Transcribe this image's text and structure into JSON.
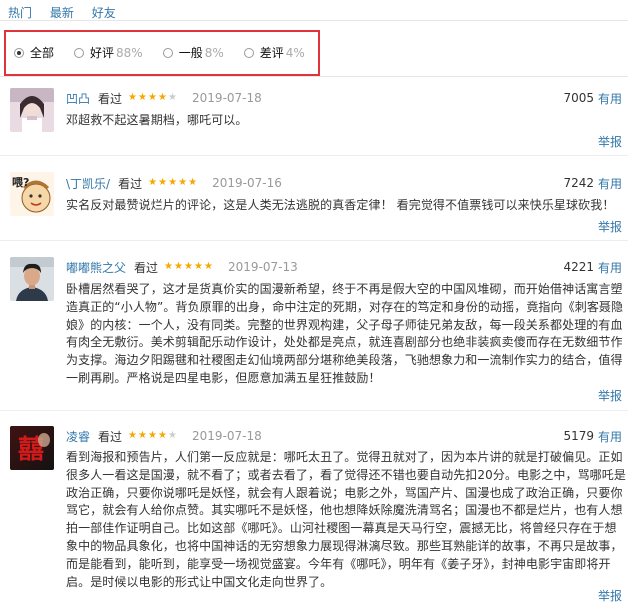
{
  "tabs": [
    "热门",
    "最新",
    "好友"
  ],
  "filters": [
    {
      "label": "全部",
      "pct": "",
      "checked": true
    },
    {
      "label": "好评",
      "pct": "88%",
      "checked": false
    },
    {
      "label": "一般",
      "pct": "8%",
      "checked": false
    },
    {
      "label": "差评",
      "pct": "4%",
      "checked": false
    }
  ],
  "colors": {
    "link": "#3377aa",
    "star": "#f4a800",
    "highlight_box": "#e0343c"
  },
  "reviews": [
    {
      "author": "凹凸",
      "watched": "看过",
      "rating": 4,
      "date": "2019-07-18",
      "votes": "7005",
      "useful": "有用",
      "report": "举报",
      "content": "邓超救不起这暑期档，哪吒可以。",
      "avatar_icon": "girl-photo-avatar"
    },
    {
      "author": "\\丁凯乐/",
      "watched": "看过",
      "rating": 5,
      "date": "2019-07-16",
      "votes": "7242",
      "useful": "有用",
      "report": "举报",
      "content": "实名反对最赞说烂片的评论，这是人类无法逃脱的真香定律！ 看完觉得不值票钱可以来快乐星球砍我！",
      "avatar_icon": "cartoon-avatar"
    },
    {
      "author": "嘟嘟熊之父",
      "watched": "看过",
      "rating": 5,
      "date": "2019-07-13",
      "votes": "4221",
      "useful": "有用",
      "report": "举报",
      "content": "卧槽居然看哭了，这才是货真价实的国漫新希望，终于不再是假大空的中国风堆砌，而开始借神话寓言塑造真正的“小人物”。背负原罪的出身，命中注定的死期，对存在的笃定和身份的动摇，竟指向《刺客聂隐娘》的内核：一个人，没有同类。完整的世界观构建，父子母子师徒兄弟友敌，每一段关系都处理的有血有肉全无敷衍。美术剪辑配乐动作设计，处处都是亮点，就连喜剧部分也绝非装疯卖傻而存在无数细节作为支撑。海边夕阳踢毽和社稷图走幻仙境两部分堪称绝美段落，飞驰想象力和一流制作实力的结合，值得一刷再刷。严格说是四星电影，但愿意加满五星狂推鼓励！",
      "avatar_icon": "man-photo-avatar"
    },
    {
      "author": "凌睿",
      "watched": "看过",
      "rating": 4,
      "date": "2019-07-18",
      "votes": "5179",
      "useful": "有用",
      "report": "举报",
      "content": "看到海报和预告片，人们第一反应就是：哪吒太丑了。觉得丑就对了，因为本片讲的就是打破偏见。正如很多人一看这是国漫，就不看了；或者去看了，看了觉得还不错也要自动先扣20分。电影之中，骂哪吒是政治正确，只要你说哪吒是妖怪，就会有人跟着说；电影之外，骂国产片、国漫也成了政治正确，只要你骂它，就会有人给你点赞。其实哪吒不是妖怪，他也想降妖除魔洗清骂名；国漫也不都是烂片，也有人想拍一部佳作证明自己。比如这部《哪吒》。山河社稷图一幕真是天马行空，震撼无比，将曾经只存在于想象中的物品具象化，也将中国神话的无穷想象力展现得淋漓尽致。那些耳熟能详的故事，不再只是故事，而是能看到，能听到，能享受一场视觉盛宴。今年有《哪吒》，明年有《姜子牙》，封神电影宇宙即将开启。是时候以电影的形式让中国文化走向世界了。",
      "avatar_icon": "movie-poster-avatar"
    }
  ]
}
